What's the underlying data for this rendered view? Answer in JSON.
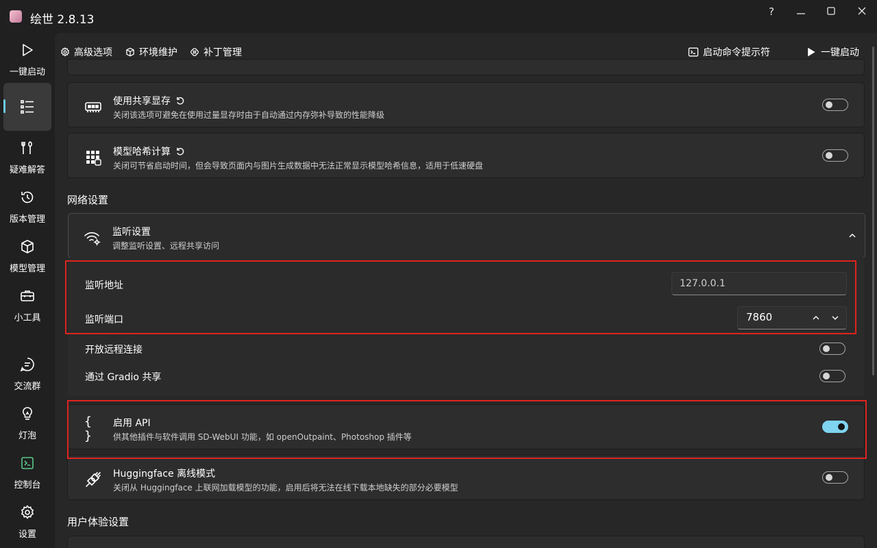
{
  "window": {
    "title": "绘世 2.8.13",
    "controls": {
      "help": "?",
      "minimize": "—",
      "maximize": "☐",
      "close": "✕"
    }
  },
  "sidebar": {
    "items": [
      {
        "label": "一键启动",
        "icon": "play-icon"
      },
      {
        "label": "",
        "icon": "list-icon",
        "active": true
      },
      {
        "label": "疑难解答",
        "icon": "wrench-icon"
      },
      {
        "label": "版本管理",
        "icon": "history-icon"
      },
      {
        "label": "模型管理",
        "icon": "cube-icon"
      },
      {
        "label": "小工具",
        "icon": "toolbox-icon"
      },
      {
        "label": "交流群",
        "icon": "chat-icon"
      },
      {
        "label": "灯泡",
        "icon": "bulb-icon"
      },
      {
        "label": "控制台",
        "icon": "console-icon"
      },
      {
        "label": "设置",
        "icon": "gear-icon"
      }
    ]
  },
  "tabs": [
    {
      "label": "高级选项",
      "icon": "gear-icon",
      "active": true
    },
    {
      "label": "环境维护",
      "icon": "package-icon"
    },
    {
      "label": "补丁管理",
      "icon": "patch-icon"
    }
  ],
  "toolbar": {
    "console_label": "启动命令提示符",
    "launch_label": "一键启动"
  },
  "settings": {
    "shared_memory": {
      "title": "使用共享显存",
      "desc": "关闭该选项可避免在使用过量显存时由于自动通过内存弥补导致的性能降级",
      "enabled": false
    },
    "model_hash": {
      "title": "模型哈希计算",
      "desc": "关闭可节省启动时间，但会导致页面内与图片生成数据中无法正常显示模型哈希信息，适用于低速硬盘",
      "enabled": false
    }
  },
  "network": {
    "section_title": "网络设置",
    "listen": {
      "title": "监听设置",
      "desc": "调整监听设置、远程共享访问"
    },
    "address_label": "监听地址",
    "address_value": "127.0.0.1",
    "port_label": "监听端口",
    "port_value": "7860",
    "remote_label": "开放远程连接",
    "remote_enabled": false,
    "gradio_label": "通过 Gradio 共享",
    "gradio_enabled": false,
    "api": {
      "title": "启用 API",
      "desc": "供其他插件与软件调用 SD-WebUI 功能，如 openOutpaint、Photoshop 插件等",
      "enabled": true
    },
    "hf": {
      "title": "Huggingface 离线模式",
      "desc": "关闭从 Huggingface 上联网加载模型的功能，启用后将无法在线下载本地缺失的部分必要模型",
      "enabled": false
    }
  },
  "ux": {
    "section_title": "用户体验设置"
  },
  "colors": {
    "accent": "#7fd4f0",
    "highlight": "#e0231f",
    "background": "#202020",
    "card": "#2d2d2d"
  }
}
